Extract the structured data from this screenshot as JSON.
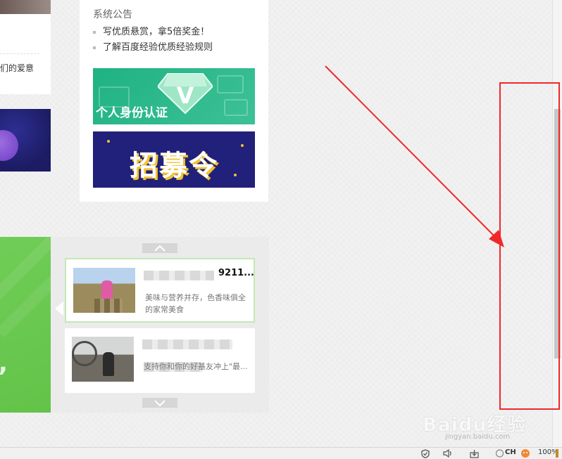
{
  "left_column": {
    "card_snippet": "们的爱意"
  },
  "notice": {
    "title": "系统公告",
    "links": [
      "写优质悬赏，拿5倍奖金！",
      "了解百度经验优质经验规则"
    ],
    "banner_id_caption": "个人身份认证",
    "banner_id_badge": "V",
    "banner_recruit_text": "招募令"
  },
  "related": {
    "cards": [
      {
        "title_fragment": "9211...",
        "desc": "美味与营养并存，色香味俱全的家常美食"
      },
      {
        "title_fragment": "",
        "desc_fragment": "支持你和你的好基友冲上\"最..."
      }
    ]
  },
  "watermark": {
    "logo": "Baidu经验",
    "sub": "jingyan.baidu.com"
  },
  "statusbar": {
    "lang": "CH",
    "zoom": "100%"
  },
  "annotation": {
    "color": "#f0282a"
  }
}
